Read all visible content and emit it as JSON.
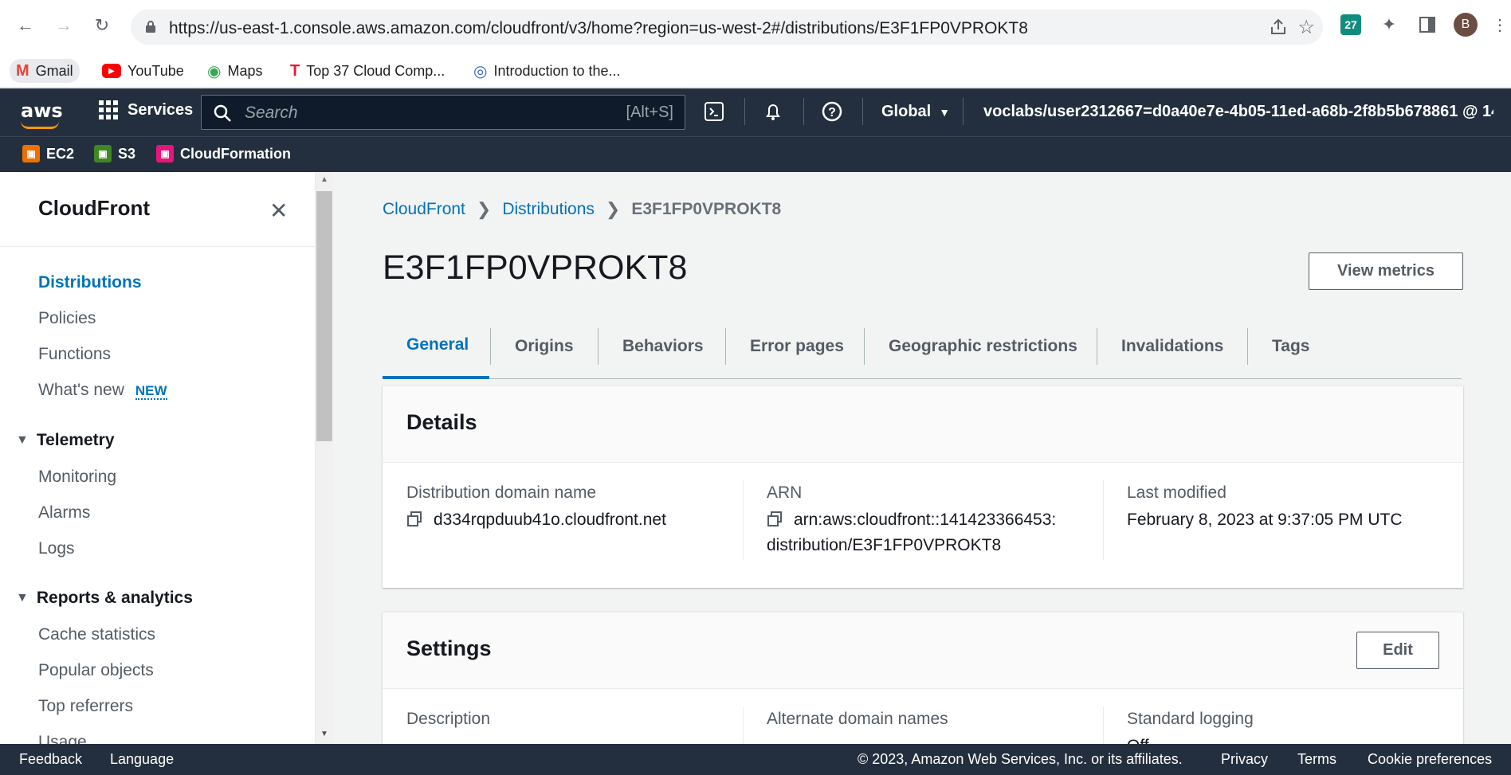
{
  "browser": {
    "url": "https://us-east-1.console.aws.amazon.com/cloudfront/v3/home?region=us-west-2#/distributions/E3F1FP0VPROKT8",
    "profile_initial": "B",
    "ext_badge": "27",
    "bookmarks": [
      "Gmail",
      "YouTube",
      "Maps",
      "Top 37 Cloud Comp...",
      "Introduction to the..."
    ]
  },
  "aws": {
    "services_label": "Services",
    "search_placeholder": "Search",
    "search_shortcut": "[Alt+S]",
    "region": "Global",
    "account": "voclabs/user2312667=d0a40e7e-4b05-11ed-a68b-2f8b5b678861 @ 14...",
    "favorites": [
      "EC2",
      "S3",
      "CloudFormation"
    ],
    "colors": {
      "header": "#232f3e",
      "accent": "#0073bb",
      "orange": "#ff9900"
    }
  },
  "sidebar": {
    "title": "CloudFront",
    "items": [
      "Distributions",
      "Policies",
      "Functions",
      "What's new"
    ],
    "new_badge": "NEW",
    "telemetry": {
      "title": "Telemetry",
      "items": [
        "Monitoring",
        "Alarms",
        "Logs"
      ]
    },
    "reports": {
      "title": "Reports & analytics",
      "items": [
        "Cache statistics",
        "Popular objects",
        "Top referrers",
        "Usage"
      ]
    }
  },
  "breadcrumb": [
    "CloudFront",
    "Distributions",
    "E3F1FP0VPROKT8"
  ],
  "page": {
    "title": "E3F1FP0VPROKT8",
    "view_metrics": "View metrics"
  },
  "tabs": [
    "General",
    "Origins",
    "Behaviors",
    "Error pages",
    "Geographic restrictions",
    "Invalidations",
    "Tags"
  ],
  "details": {
    "heading": "Details",
    "domain_label": "Distribution domain name",
    "domain_value": "d334rqpduub41o.cloudfront.net",
    "arn_label": "ARN",
    "arn_line1": "arn:aws:cloudfront::141423366453:",
    "arn_line2": "distribution/E3F1FP0VPROKT8",
    "modified_label": "Last modified",
    "modified_value": "February 8, 2023 at 9:37:05 PM UTC"
  },
  "settings": {
    "heading": "Settings",
    "edit": "Edit",
    "description_label": "Description",
    "alt_domains_label": "Alternate domain names",
    "logging_label": "Standard logging",
    "logging_value": "Off"
  },
  "footer": {
    "feedback": "Feedback",
    "language": "Language",
    "copyright": "© 2023, Amazon Web Services, Inc. or its affiliates.",
    "privacy": "Privacy",
    "terms": "Terms",
    "cookies": "Cookie preferences"
  }
}
